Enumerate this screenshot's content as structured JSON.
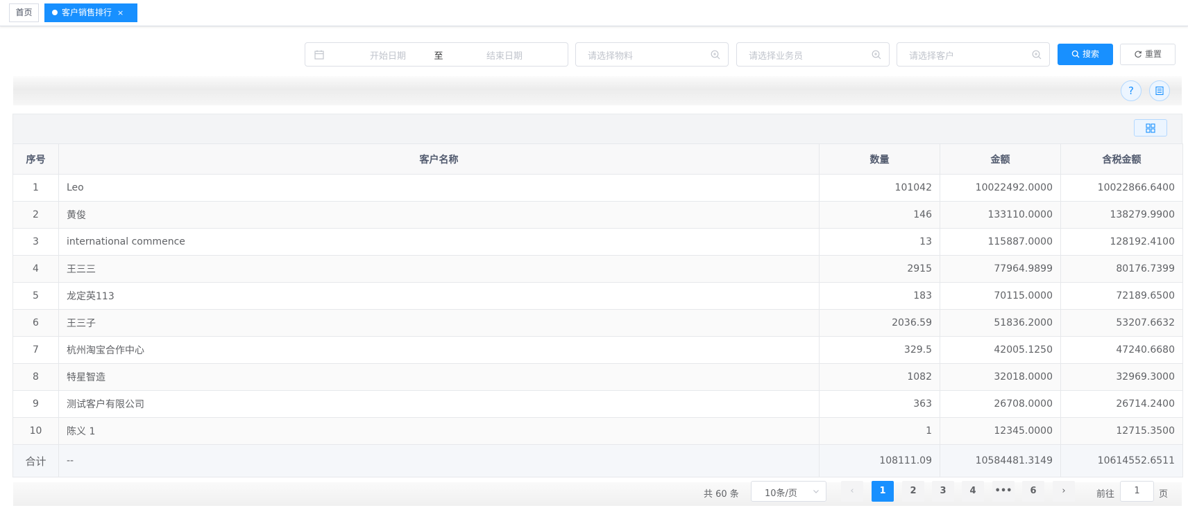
{
  "tabs": {
    "home_label": "首页",
    "active_label": "客户销售排行",
    "close_glyph": "×"
  },
  "search": {
    "start_date_placeholder": "开始日期",
    "range_separator": "至",
    "end_date_placeholder": "结束日期",
    "material_placeholder": "请选择物料",
    "salesman_placeholder": "请选择业务员",
    "customer_placeholder": "请选择客户",
    "search_label": "搜索",
    "reset_label": "重置"
  },
  "toolbar": {
    "help_glyph": "?"
  },
  "table": {
    "columns": [
      "序号",
      "客户名称",
      "数量",
      "金额",
      "含税金额"
    ],
    "rows": [
      {
        "idx": "1",
        "name": "Leo",
        "qty": "101042",
        "amount": "10022492.0000",
        "tax_amount": "10022866.6400"
      },
      {
        "idx": "2",
        "name": "黄俊",
        "qty": "146",
        "amount": "133110.0000",
        "tax_amount": "138279.9900"
      },
      {
        "idx": "3",
        "name": "international commence",
        "qty": "13",
        "amount": "115887.0000",
        "tax_amount": "128192.4100"
      },
      {
        "idx": "4",
        "name": "王三三",
        "qty": "2915",
        "amount": "77964.9899",
        "tax_amount": "80176.7399"
      },
      {
        "idx": "5",
        "name": "龙定英113",
        "qty": "183",
        "amount": "70115.0000",
        "tax_amount": "72189.6500"
      },
      {
        "idx": "6",
        "name": "王三子",
        "qty": "2036.59",
        "amount": "51836.2000",
        "tax_amount": "53207.6632"
      },
      {
        "idx": "7",
        "name": "杭州淘宝合作中心",
        "qty": "329.5",
        "amount": "42005.1250",
        "tax_amount": "47240.6680"
      },
      {
        "idx": "8",
        "name": "特星智造",
        "qty": "1082",
        "amount": "32018.0000",
        "tax_amount": "32969.3000"
      },
      {
        "idx": "9",
        "name": "测试客户有限公司",
        "qty": "363",
        "amount": "26708.0000",
        "tax_amount": "26714.2400"
      },
      {
        "idx": "10",
        "name": "陈义 1",
        "qty": "1",
        "amount": "12345.0000",
        "tax_amount": "12715.3500"
      }
    ],
    "summary": {
      "idx": "合计",
      "name": "--",
      "qty": "108111.09",
      "amount": "10584481.3149",
      "tax_amount": "10614552.6511"
    }
  },
  "pagination": {
    "total_text": "共 60 条",
    "page_size": "10条/页",
    "pages": [
      "1",
      "2",
      "3",
      "4",
      "•••",
      "6"
    ],
    "current_page": "1",
    "prev_glyph": "‹",
    "next_glyph": "›",
    "goto_label": "前往",
    "goto_value": "1",
    "page_unit": "页"
  },
  "colors": {
    "primary": "#1890ff",
    "border": "#dcdfe6",
    "header_bg": "#f8f8f9"
  }
}
